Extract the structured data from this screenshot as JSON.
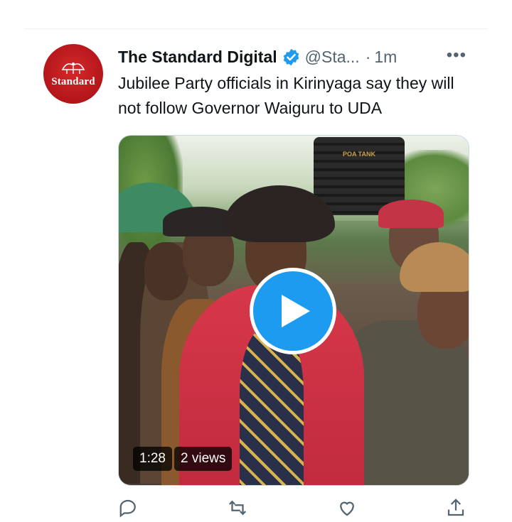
{
  "tweet": {
    "author_name": "The Standard Digital",
    "handle": "@Sta...",
    "separator": "·",
    "time": "1m",
    "more": "•••",
    "text": "Jubilee Party officials in Kirinyaga say they will not follow Governor Waiguru to UDA",
    "avatar_text": "Standard"
  },
  "media": {
    "tank_label": "POA TANK",
    "duration": "1:28",
    "views": "2 views"
  },
  "colors": {
    "accent": "#1d9bf0",
    "avatar_red": "#b3151a",
    "secondary_text": "#536471"
  },
  "icons": {
    "verified": "verified-badge-icon",
    "play": "play-icon",
    "more": "more-dots-icon",
    "reply": "reply-icon",
    "retweet": "retweet-icon",
    "like": "like-icon",
    "share": "share-icon"
  }
}
